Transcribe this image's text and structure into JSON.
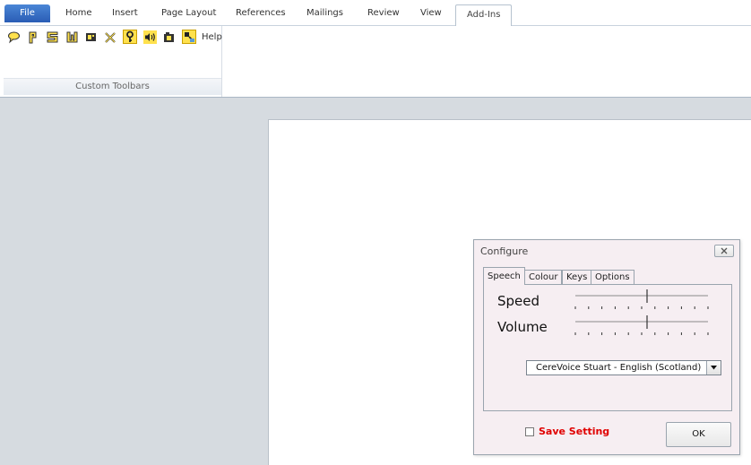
{
  "ribbon": {
    "file_label": "File",
    "tabs": [
      {
        "label": "Home"
      },
      {
        "label": "Insert"
      },
      {
        "label": "Page Layout"
      },
      {
        "label": "References"
      },
      {
        "label": "Mailings"
      },
      {
        "label": "Review"
      },
      {
        "label": "View"
      },
      {
        "label": "Add-Ins"
      }
    ],
    "active_tab": "Add-Ins",
    "group_label": "Custom Toolbars",
    "help_label": "Help",
    "toolbar_icons": [
      "speech-bubble-icon",
      "p-icon",
      "s-icon",
      "w-icon",
      "screen-icon",
      "cross-tools-icon",
      "key-icon",
      "speaker-icon",
      "camera-icon",
      "magnifier-icon"
    ]
  },
  "dialog": {
    "title": "Configure",
    "tabs": [
      {
        "label": "Speech"
      },
      {
        "label": "Colour"
      },
      {
        "label": "Keys"
      },
      {
        "label": "Options"
      }
    ],
    "active_tab": "Speech",
    "speed_label": "Speed",
    "speed_value": 0.5,
    "volume_label": "Volume",
    "volume_value": 0.5,
    "voice_value": "CereVoice Stuart - English (Scotland)",
    "save_label": "Save Setting",
    "save_checked": false,
    "ok_label": "OK"
  },
  "colors": {
    "file_tab": "#2a5db5",
    "toolbar_icon": "#ffe14d",
    "save_label": "#e00000",
    "dialog_bg": "#f6eef2"
  }
}
